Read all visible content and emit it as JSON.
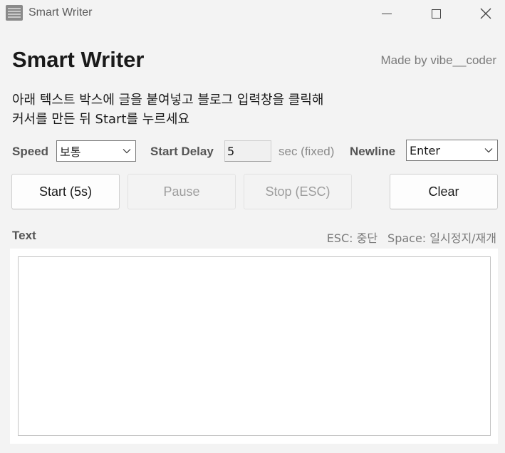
{
  "window": {
    "title": "Smart Writer",
    "icon": "app-icon"
  },
  "header": {
    "heading": "Smart Writer",
    "credit": "Made by vibe__coder"
  },
  "instructions": {
    "line1": "아래 텍스트 박스에 글을 붙여넣고 블로그 입력창을 클릭해",
    "line2": "커서를 만든 뒤 Start를 누르세요"
  },
  "controls": {
    "speed_label": "Speed",
    "speed_value": "보통",
    "delay_label": "Start Delay",
    "delay_value": "5",
    "delay_unit": "sec (fixed)",
    "newline_label": "Newline",
    "newline_value": "Enter"
  },
  "buttons": {
    "start": "Start (5s)",
    "pause": "Pause",
    "stop": "Stop (ESC)",
    "clear": "Clear"
  },
  "text_section": {
    "label": "Text",
    "hint_esc": "ESC: 중단",
    "hint_space": "Space: 일시정지/재개",
    "content": ""
  },
  "colors": {
    "background": "#f3f3f3",
    "panel": "#ffffff",
    "disabled_text": "#9d9d9d"
  }
}
